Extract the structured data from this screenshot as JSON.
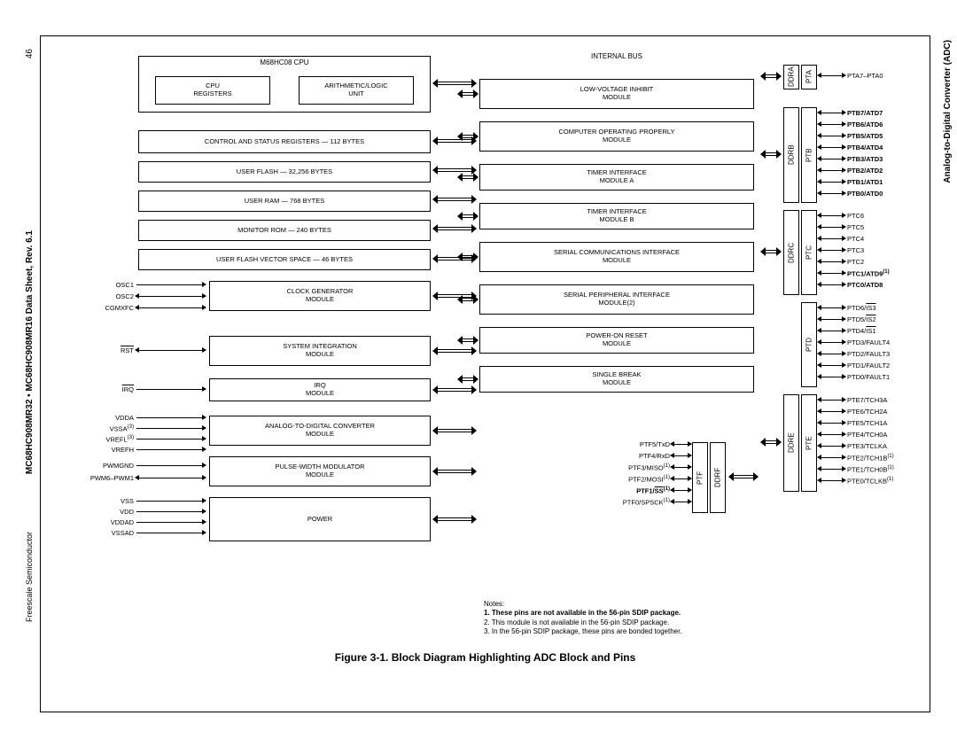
{
  "page_number": "46",
  "header_right": "Analog-to-Digital Converter (ADC)",
  "footer_center": "MC68HC908MR32 • MC68HC908MR16 Data Sheet, Rev. 6.1",
  "footer_right": "Freescale Semiconductor",
  "caption": "Figure 3-1. Block Diagram Highlighting ADC Block and Pins",
  "bus_label": "INTERNAL BUS",
  "cpu": {
    "title": "M68HC08 CPU",
    "left": "CPU\nREGISTERS",
    "right": "ARITHMETIC/LOGIC\nUNIT"
  },
  "left_blocks": [
    "CONTROL AND STATUS REGISTERS — 112 BYTES",
    "USER FLASH — 32,256 BYTES",
    "USER RAM — 768 BYTES",
    "MONITOR ROM — 240 BYTES",
    "USER FLASH VECTOR SPACE — 46 BYTES",
    "CLOCK GENERATOR\nMODULE",
    "SYSTEM INTEGRATION\nMODULE",
    "IRQ\nMODULE",
    "ANALOG-TO-DIGITAL CONVERTER\nMODULE",
    "PULSE-WIDTH MODULATOR\nMODULE",
    "POWER"
  ],
  "right_blocks": [
    "LOW-VOLTAGE INHIBIT\nMODULE",
    "COMPUTER OPERATING PROPERLY\nMODULE",
    "TIMER INTERFACE\nMODULE A",
    "TIMER INTERFACE\nMODULE B",
    "SERIAL COMMUNICATIONS INTERFACE\nMODULE",
    "SERIAL PERIPHERAL INTERFACE\nMODULE(2)",
    "POWER-ON RESET\nMODULE",
    "SINGLE BREAK\nMODULE"
  ],
  "left_pins_upper": [
    "OSC1",
    "OSC2",
    "CGMXFC"
  ],
  "left_pin_rst": "RST",
  "left_pin_irq": "IRQ",
  "left_pins_adc": [
    "VDDA",
    "VSSA(3)",
    "VREFL(3)",
    "VREFH"
  ],
  "left_pins_pwm": [
    "PWMGND",
    "PWM6–PWM1"
  ],
  "left_pins_pwr": [
    "VSS",
    "VDD",
    "VDDAD",
    "VSSAD"
  ],
  "ptf_pins": [
    "PTF5/TxD",
    "PTF4/RxD",
    "PTF3/MISO(1)",
    "PTF2/MOSI(1)",
    "PTF1/SS(1)",
    "PTF0/SPSCK(1)"
  ],
  "ports": {
    "pta": {
      "ddr": "DDRA",
      "pt": "PTA",
      "pins": [
        "PTA7–PTA0"
      ]
    },
    "ptb": {
      "ddr": "DDRB",
      "pt": "PTB",
      "pins": [
        "PTB7/ATD7",
        "PTB6/ATD6",
        "PTB5/ATD5",
        "PTB4/ATD4",
        "PTB3/ATD3",
        "PTB2/ATD2",
        "PTB1/ATD1",
        "PTB0/ATD0"
      ],
      "bold": true
    },
    "ptc": {
      "ddr": "DDRC",
      "pt": "PTC",
      "pins": [
        "PTC6",
        "PTC5",
        "PTC4",
        "PTC3",
        "PTC2",
        "PTC1/ATD9(1)",
        "PTC0/ATD8"
      ],
      "bold_from": 5
    },
    "ptd": {
      "ddr": "",
      "pt": "PTD",
      "pins": [
        "PTD6/IS3",
        "PTD5/IS2",
        "PTD4/IS1",
        "PTD3/FAULT4",
        "PTD2/FAULT3",
        "PTD1/FAULT2",
        "PTD0/FAULT1"
      ]
    },
    "pte": {
      "ddr": "DDRE",
      "pt": "PTE",
      "pins": [
        "PTE7/TCH3A",
        "PTE6/TCH2A",
        "PTE5/TCH1A",
        "PTE4/TCH0A",
        "PTE3/TCLKA",
        "PTE2/TCH1B(1)",
        "PTE1/TCH0B(1)",
        "PTE0/TCLKB(1)"
      ]
    },
    "ptf": {
      "ddr": "DDRF",
      "pt": "PTF"
    }
  },
  "notes": {
    "title": "Notes:",
    "n1": "1. These pins are not available in the 56-pin SDIP package.",
    "n2": "2. This module is not available in the 56-pin SDIP package.",
    "n3": "3. In the 56-pin SDIP package, these pins are bonded together."
  }
}
